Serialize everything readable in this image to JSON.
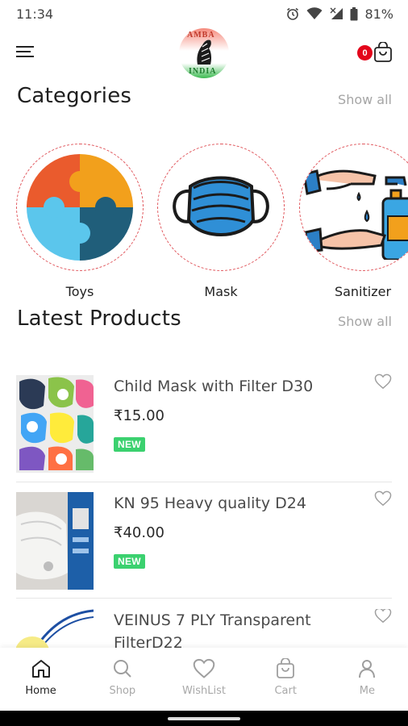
{
  "status_bar": {
    "time": "11:34",
    "battery": "81%"
  },
  "header": {
    "logo_text_top": "AMBA",
    "logo_text_bottom": "INDIA",
    "cart_count": "0"
  },
  "categories_section": {
    "title": "Categories",
    "show_all": "Show all",
    "items": [
      {
        "label": "Toys"
      },
      {
        "label": "Mask"
      },
      {
        "label": "Sanitizer"
      }
    ]
  },
  "products_section": {
    "title": "Latest Products",
    "show_all": "Show all",
    "items": [
      {
        "name": "Child Mask with Filter D30",
        "price": "₹15.00",
        "badge": "NEW"
      },
      {
        "name": "KN 95 Heavy quality D24",
        "price": "₹40.00",
        "badge": "NEW"
      },
      {
        "name": "VEINUS 7 PLY Transparent FilterD22"
      }
    ]
  },
  "bottom_nav": {
    "items": [
      {
        "label": "Home",
        "icon": "home-icon",
        "active": true
      },
      {
        "label": "Shop",
        "icon": "search-icon"
      },
      {
        "label": "WishList",
        "icon": "heart-icon"
      },
      {
        "label": "Cart",
        "icon": "bag-icon"
      },
      {
        "label": "Me",
        "icon": "person-icon"
      }
    ]
  },
  "colors": {
    "badge_red": "#e3051b",
    "new_green": "#3bd16f",
    "dashed_circle": "#e0545a",
    "muted_text": "#a5a5a5"
  }
}
